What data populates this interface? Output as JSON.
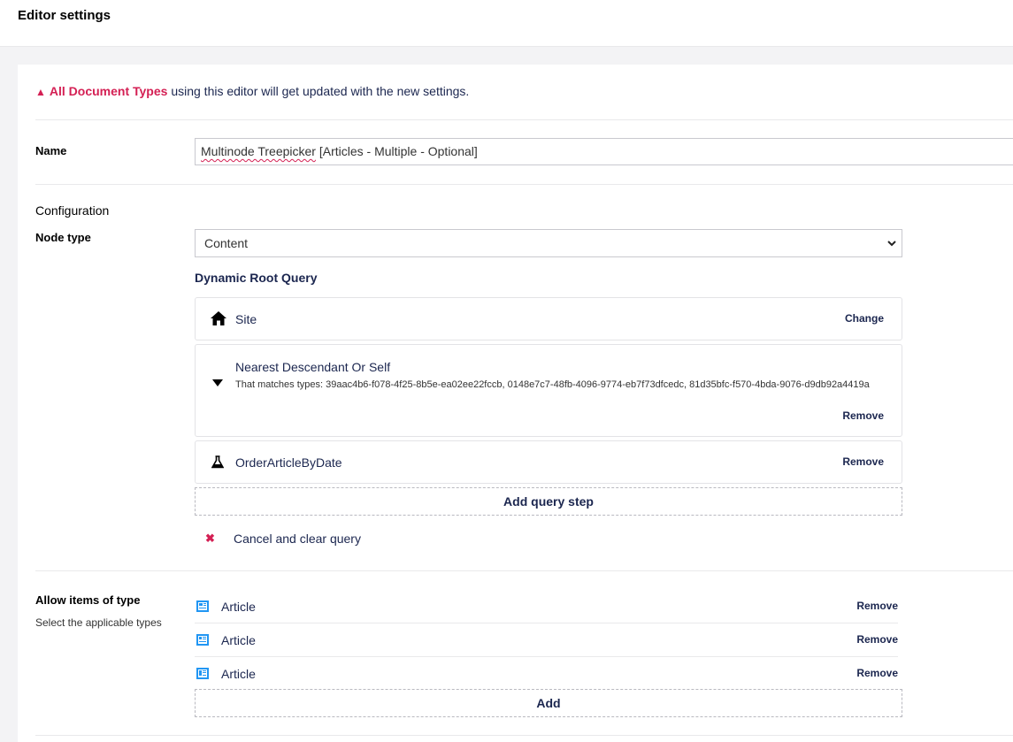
{
  "header": {
    "title": "Editor settings"
  },
  "warning": {
    "highlight": "All Document Types",
    "text": " using this editor will get updated with the new settings."
  },
  "name": {
    "label": "Name",
    "value_squiggle": "Multinode Treepicker",
    "value_rest": " [Articles - Multiple - Optional]"
  },
  "configuration": {
    "label": "Configuration",
    "node_type": {
      "label": "Node type",
      "selected": "Content"
    },
    "dynamic_root": {
      "heading": "Dynamic Root Query",
      "origin": {
        "icon": "home-icon",
        "title": "Site",
        "action": "Change"
      },
      "steps": [
        {
          "icon": "caret-down-icon",
          "title": "Nearest Descendant Or Self",
          "description": "That matches types: 39aac4b6-f078-4f25-8b5e-ea02ee22fccb, 0148e7c7-48fb-4096-9774-eb7f73dfcedc, 81d35bfc-f570-4bda-9076-d9db92a4419a",
          "action": "Remove"
        },
        {
          "icon": "flask-icon",
          "title": "OrderArticleByDate",
          "action": "Remove"
        }
      ],
      "add_step_label": "Add query step",
      "cancel_label": "Cancel and clear query"
    }
  },
  "allowed": {
    "label": "Allow items of type",
    "sublabel": "Select the applicable types",
    "items": [
      {
        "name": "Article",
        "action": "Remove",
        "icon": "document-type-icon"
      },
      {
        "name": "Article",
        "action": "Remove",
        "icon": "document-type-icon"
      },
      {
        "name": "Article",
        "action": "Remove",
        "icon": "document-type-icon"
      }
    ],
    "add_label": "Add"
  },
  "colors": {
    "accent": "#d42054",
    "text": "#1b264f",
    "icon_blue": "#2196f3"
  }
}
